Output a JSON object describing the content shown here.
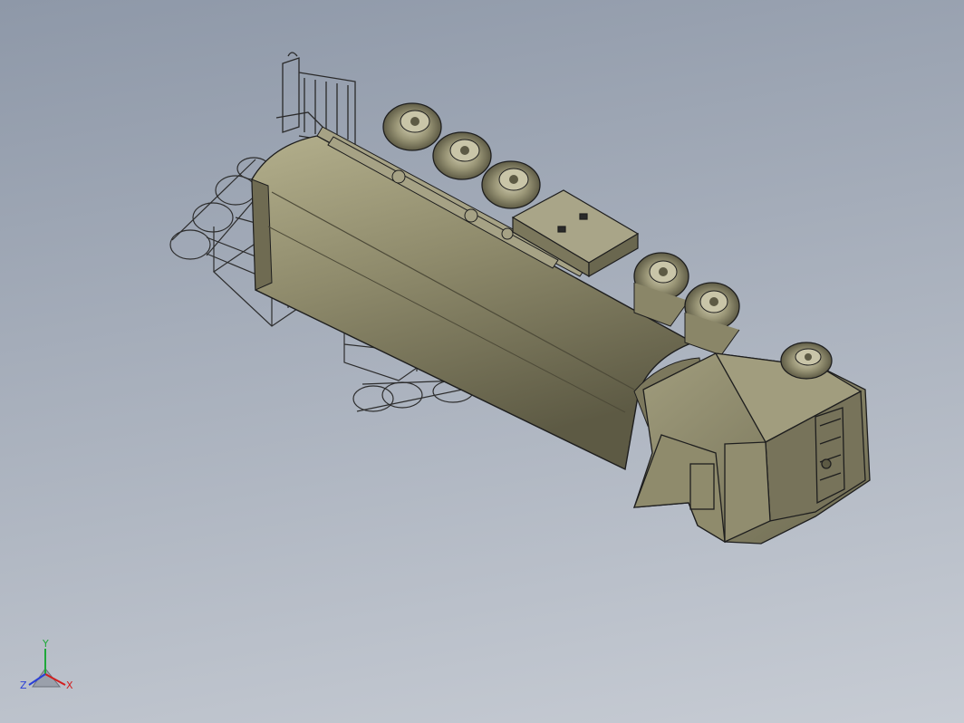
{
  "viewport": {
    "background_top": "#8e98a8",
    "background_bottom": "#c7ccd4",
    "model_color": "#8f8b6c",
    "model_shade": "#6f6b52",
    "edge_color": "#1e1e1e"
  },
  "triad": {
    "x_label": "X",
    "y_label": "Y",
    "z_label": "Z",
    "x_color": "#d21e1e",
    "y_color": "#1fa83a",
    "z_color": "#2a3fd6"
  }
}
